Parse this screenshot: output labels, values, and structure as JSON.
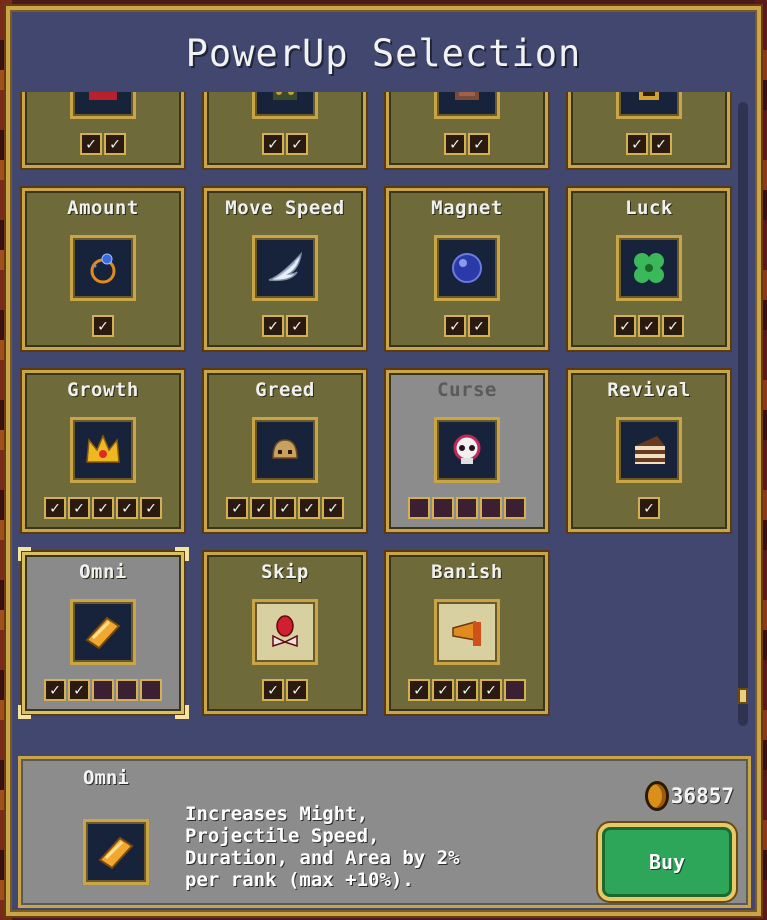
{
  "title": "PowerUp Selection",
  "check_mark": "✓",
  "top_row": [
    {
      "ranks": [
        true,
        true
      ]
    },
    {
      "ranks": [
        true,
        true
      ]
    },
    {
      "ranks": [
        true,
        true
      ]
    },
    {
      "ranks": [
        true,
        true
      ]
    }
  ],
  "cards": {
    "amount": {
      "label": "Amount",
      "ranks": [
        true
      ]
    },
    "move_speed": {
      "label": "Move Speed",
      "ranks": [
        true,
        true
      ]
    },
    "magnet": {
      "label": "Magnet",
      "ranks": [
        true,
        true
      ]
    },
    "luck": {
      "label": "Luck",
      "ranks": [
        true,
        true,
        true
      ]
    },
    "growth": {
      "label": "Growth",
      "ranks": [
        true,
        true,
        true,
        true,
        true
      ]
    },
    "greed": {
      "label": "Greed",
      "ranks": [
        true,
        true,
        true,
        true,
        true
      ]
    },
    "curse": {
      "label": "Curse",
      "ranks": [
        false,
        false,
        false,
        false,
        false
      ]
    },
    "revival": {
      "label": "Revival",
      "ranks": [
        true
      ]
    },
    "omni": {
      "label": "Omni",
      "ranks": [
        true,
        true,
        false,
        false,
        false
      ]
    },
    "skip": {
      "label": "Skip",
      "ranks": [
        true,
        true
      ]
    },
    "banish": {
      "label": "Banish",
      "ranks": [
        true,
        true,
        true,
        true,
        false
      ]
    }
  },
  "selected": {
    "name": "Omni",
    "description": "Increases Might,\nProjectile Speed,\nDuration, and Area by 2%\nper rank (max +10%).",
    "coins": "36857",
    "buy_label": "Buy"
  },
  "colors": {
    "panel": "#41476e",
    "card": "#6e6a3a",
    "card_disabled": "#8c8c8c",
    "gold_border": "#c9a548",
    "buy_button": "#2ea65a"
  }
}
